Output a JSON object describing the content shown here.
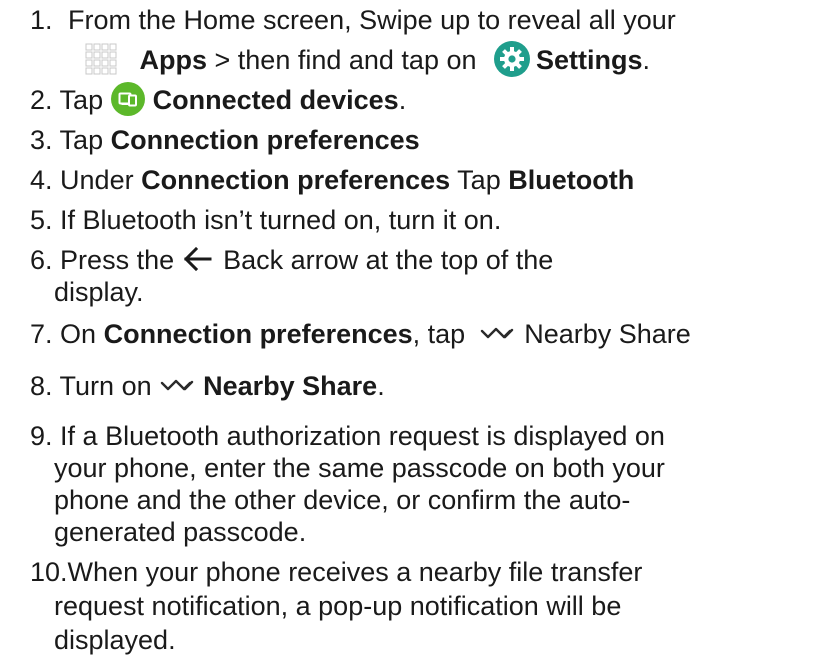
{
  "steps": [
    {
      "num": "1.",
      "lines": [
        {
          "t": "From the Home screen, Swipe up to reveal all your"
        },
        {
          "icon": "apps-grid-icon",
          "b": "Apps",
          "t2": " > then find and tap on ",
          "icon2": "settings-gear-icon",
          "b2": "Settings",
          "t3": "."
        }
      ]
    },
    {
      "num": "2.",
      "t": "Tap ",
      "icon": "connected-devices-icon",
      "b": "Connected devices",
      "t2": "."
    },
    {
      "num": "3.",
      "t": "Tap ",
      "b": "Connection preferences"
    },
    {
      "num": "4.",
      "t": "Under ",
      "b": "Connection preferences",
      "t2": " Tap ",
      "b2": "Bluetooth"
    },
    {
      "num": "5.",
      "t": "If Bluetooth isn’t turned on, turn it on."
    },
    {
      "num": "6.",
      "lines": [
        {
          "t": "Press the ",
          "icon": "back-arrow-icon",
          "t2": " Back arrow at the top of the"
        },
        {
          "t": "display."
        }
      ]
    },
    {
      "num": "7.",
      "t": "On ",
      "b": "Connection preferences",
      "t2": ", tap ",
      "icon": "nearby-share-icon",
      "t3": " Nearby Share"
    },
    {
      "num": "8.",
      "t": "Turn on ",
      "icon": "nearby-share-icon",
      "b": "Nearby Share",
      "t2": "."
    },
    {
      "num": "9.",
      "lines": [
        {
          "t": "If a Bluetooth authorization request is displayed on"
        },
        {
          "t": "your phone, enter the same passcode on both your"
        },
        {
          "t": "phone and the other device, or confirm the auto-"
        },
        {
          "t": "generated passcode."
        }
      ]
    },
    {
      "num": "10.",
      "lines": [
        {
          "t": "When your phone receives a nearby file transfer"
        },
        {
          "t": "request notification, a pop-up notification will be"
        },
        {
          "t": "displayed."
        }
      ]
    }
  ],
  "colors": {
    "text": "#1a1a1a",
    "settings_icon": "#1f9e8c",
    "connected_devices_icon": "#5cb82a"
  }
}
